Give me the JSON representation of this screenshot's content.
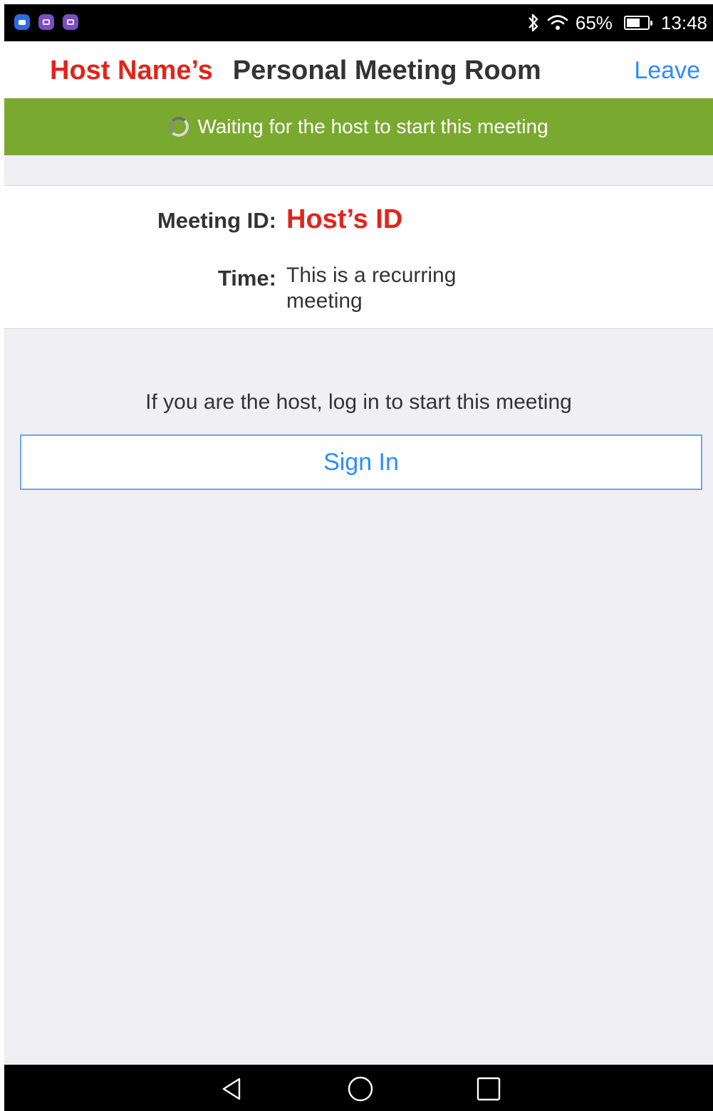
{
  "status_bar": {
    "notifications": [
      "zoom-notification-icon",
      "gallery-notification-icon",
      "screenshot-notification-icon"
    ],
    "battery": "65%",
    "time": "13:48",
    "battery_level": 0.65
  },
  "header": {
    "host_name": "Host Name’s",
    "room_title": "Personal Meeting Room",
    "leave_label": "Leave"
  },
  "banner": {
    "message": "Waiting for the host to start this meeting"
  },
  "meeting": {
    "id_label": "Meeting ID:",
    "id_value": "Host’s ID",
    "time_label": "Time:",
    "time_value": "This is a recurring meeting"
  },
  "host_prompt": {
    "message": "If you are the host, log in to start this meeting",
    "sign_in_label": "Sign In"
  },
  "nav": {
    "icons": [
      "back-icon",
      "home-icon",
      "recent-apps-icon"
    ]
  },
  "colors": {
    "accent_blue": "#2d8cff",
    "host_red": "#e1251b",
    "banner_green": "#7aa92f",
    "background": "#efeff4"
  }
}
